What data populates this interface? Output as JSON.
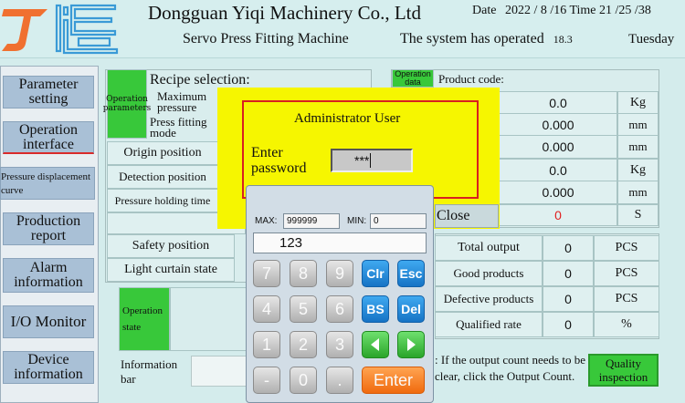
{
  "header": {
    "company": "Dongguan Yiqi Machinery Co., Ltd",
    "machine": "Servo Press Fitting Machine",
    "date_label": "Date",
    "year": "2022",
    "month": "8",
    "day": "16",
    "time_label": "Time",
    "hour": "21",
    "minute": "25",
    "second": "38",
    "operated_label": "The system has operated",
    "operated_value": "18.3",
    "weekday": "Tuesday"
  },
  "sidebar": {
    "items": [
      {
        "label": "Parameter setting"
      },
      {
        "label": "Operation interface"
      },
      {
        "label": "Pressure displacement curve"
      },
      {
        "label": "Production report"
      },
      {
        "label": "Alarm information"
      },
      {
        "label": "I/O Monitor"
      },
      {
        "label": "Device information"
      }
    ]
  },
  "recipe": {
    "tag": "Operation parameters",
    "title": "Recipe selection:",
    "rows": [
      "Maximum pressure",
      "Press fitting mode",
      "Origin position",
      "Detection position",
      "Pressure holding time",
      "Safety position",
      "Light curtain state"
    ]
  },
  "product": {
    "tag": "Operation data",
    "code_label": "Product code:",
    "values": [
      {
        "value": "0.0",
        "unit": "Kg"
      },
      {
        "value": "0.000",
        "unit": "mm"
      },
      {
        "value": "0.000",
        "unit": "mm"
      },
      {
        "value": "0.0",
        "unit": "Kg"
      },
      {
        "value": "0.000",
        "unit": "mm"
      },
      {
        "value": "0",
        "unit": "S"
      }
    ]
  },
  "output": {
    "rows": [
      {
        "label": "Total output",
        "value": "0",
        "unit": "PCS"
      },
      {
        "label": "Good products",
        "value": "0",
        "unit": "PCS"
      },
      {
        "label": "Defective products",
        "value": "0",
        "unit": "PCS"
      },
      {
        "label": "Qualified rate",
        "value": "0",
        "unit": "%"
      }
    ],
    "note": ": If the output count needs to be clear, click the Output Count.",
    "quality_button": "Quality inspection"
  },
  "state": {
    "label": "Operation state"
  },
  "info": {
    "label": "Information bar"
  },
  "admin": {
    "title": "Administrator User",
    "enter_label": "Enter password",
    "password": "***",
    "close": "Close"
  },
  "keypad": {
    "max_label": "MAX:",
    "max_value": "999999",
    "min_label": "MIN:",
    "min_value": "0",
    "display": "123",
    "keys": {
      "k7": "7",
      "k8": "8",
      "k9": "9",
      "clr": "Clr",
      "esc": "Esc",
      "k4": "4",
      "k5": "5",
      "k6": "6",
      "bs": "BS",
      "del": "Del",
      "k1": "1",
      "k2": "2",
      "k3": "3",
      "k0": "0",
      "dot": ".",
      "minus": "-",
      "enter": "Enter"
    }
  },
  "colors": {
    "background": "#d4ecec",
    "green_tag": "#38c83a",
    "admin_yellow": "#f6f600",
    "admin_border": "#d82020",
    "nav_button": "#a9c0d6",
    "keypad_blue": "#1e88e5",
    "keypad_enter": "#f58220",
    "logo_orange": "#f07030"
  }
}
